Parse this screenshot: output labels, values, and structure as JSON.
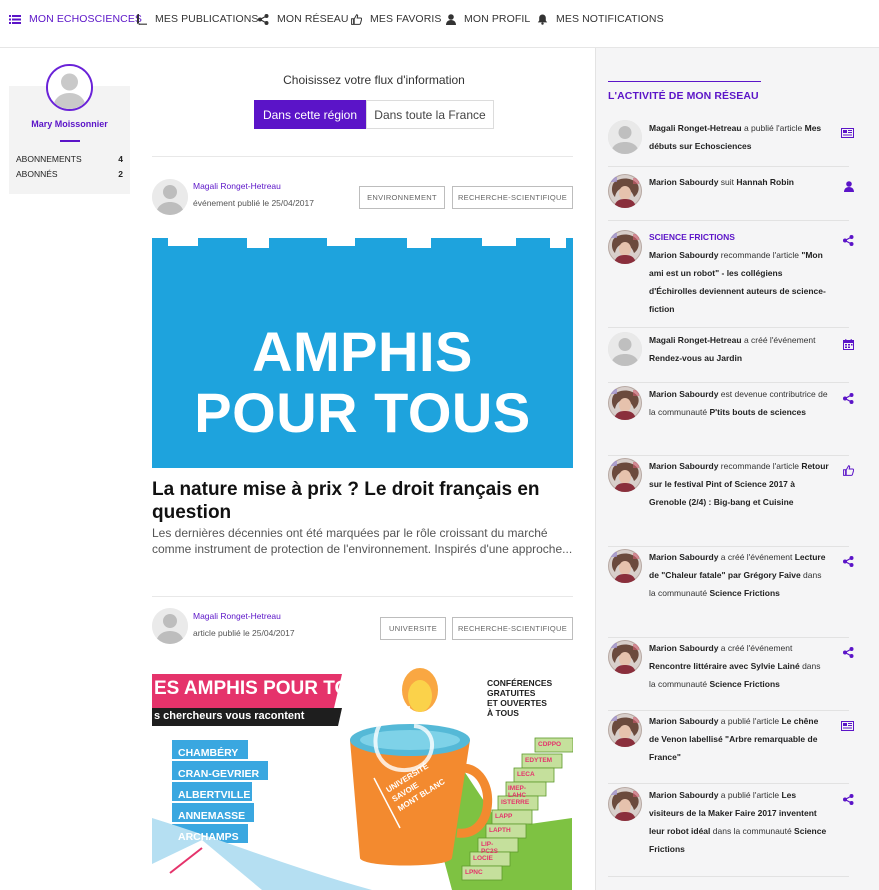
{
  "nav": {
    "items": [
      {
        "label": "MON ECHOSCIENCES",
        "icon": "list-icon",
        "active": true
      },
      {
        "label": "MES PUBLICATIONS",
        "icon": "book-icon",
        "active": false
      },
      {
        "label": "MON RÉSEAU",
        "icon": "share-icon",
        "active": false
      },
      {
        "label": "MES FAVORIS",
        "icon": "thumbs-up-icon",
        "active": false
      },
      {
        "label": "MON PROFIL",
        "icon": "user-icon",
        "active": false
      },
      {
        "label": "MES NOTIFICATIONS",
        "icon": "bell-icon",
        "active": false
      }
    ]
  },
  "profile": {
    "name": "Mary Moissonnier",
    "stats": [
      {
        "label": "ABONNEMENTS",
        "value": "4"
      },
      {
        "label": "ABONNÉS",
        "value": "2"
      }
    ]
  },
  "feed": {
    "title": "Choisissez votre flux d'information",
    "options": [
      "Dans cette région",
      "Dans toute la France"
    ],
    "selected": "Dans cette région",
    "posts": [
      {
        "author": "Magali Ronget-Hetreau",
        "meta": "événement publié le 25/04/2017",
        "tags": [
          "ENVIRONNEMENT",
          "RECHERCHE-SCIENTIFIQUE"
        ],
        "image_text": [
          "AMPHIS",
          "POUR TOUS"
        ],
        "title": "La nature mise à prix ? Le droit français en question",
        "excerpt": "Les dernières décennies ont été marquées par le rôle croissant du marché comme instrument de protection de l'environnement. Inspirés d'une approche..."
      },
      {
        "author": "Magali Ronget-Hetreau",
        "meta": "article publié le 25/04/2017",
        "tags": [
          "UNIVERSITE",
          "RECHERCHE-SCIENTIFIQUE"
        ],
        "image_text": {
          "banner": "ES AMPHIS POUR TOUS",
          "subtitle": "s chercheurs vous racontent",
          "cities": [
            "CHAMBÉRY",
            "CRAN-GEVRIER",
            "ALBERTVILLE",
            "ANNEMASSE",
            "ARCHAMPS"
          ],
          "tagline": [
            "CONFÉRENCES",
            "GRATUITES",
            "ET OUVERTES",
            "À TOUS"
          ],
          "mug": [
            "UNIVERSITÉ",
            "SAVOIE",
            "MONT BLANC"
          ],
          "files": [
            "CDPPO",
            "EDYTEM",
            "LECA",
            "IMEP-LAHC",
            "ISTERRE",
            "LAPP",
            "LAPTH",
            "LIP-PC2S",
            "LOCIE",
            "LPNC"
          ]
        }
      }
    ]
  },
  "activity": {
    "title": "L'ACTIVITÉ DE MON RÉSEAU",
    "items": [
      {
        "icon": "newspaper-icon",
        "avatar": "default",
        "group": "",
        "parts": [
          [
            "b",
            "Magali Ronget-Hetreau"
          ],
          [
            "t",
            " a publié l'article "
          ],
          [
            "b",
            "Mes débuts sur Echosciences"
          ]
        ]
      },
      {
        "icon": "user-icon",
        "avatar": "photo",
        "group": "",
        "parts": [
          [
            "b",
            "Marion Sabourdy"
          ],
          [
            "t",
            " suit "
          ],
          [
            "b",
            "Hannah Robin"
          ]
        ]
      },
      {
        "icon": "share-icon",
        "avatar": "photo",
        "group": "SCIENCE FRICTIONS",
        "parts": [
          [
            "b",
            "Marion Sabourdy"
          ],
          [
            "t",
            " recommande l'article "
          ],
          [
            "b",
            "\"Mon ami est un robot\" - les collégiens d'Échirolles deviennent auteurs de science-fiction"
          ]
        ]
      },
      {
        "icon": "calendar-icon",
        "avatar": "default",
        "group": "",
        "parts": [
          [
            "b",
            "Magali Ronget-Hetreau"
          ],
          [
            "t",
            " a créé l'événement "
          ],
          [
            "b",
            "Rendez-vous au Jardin"
          ]
        ]
      },
      {
        "icon": "share-icon",
        "avatar": "photo",
        "group": "",
        "parts": [
          [
            "b",
            "Marion Sabourdy"
          ],
          [
            "t",
            " est devenue contributrice de la communauté "
          ],
          [
            "b",
            "P'tits bouts de sciences"
          ]
        ]
      },
      {
        "icon": "thumbs-up-icon",
        "avatar": "photo",
        "group": "",
        "parts": [
          [
            "b",
            "Marion Sabourdy"
          ],
          [
            "t",
            " recommande l'article "
          ],
          [
            "b",
            "Retour sur le festival Pint of Science 2017 à Grenoble (2/4) : Big-bang et Cuisine"
          ]
        ]
      },
      {
        "icon": "share-icon",
        "avatar": "photo",
        "group": "",
        "parts": [
          [
            "b",
            "Marion Sabourdy"
          ],
          [
            "t",
            " a créé l'événement "
          ],
          [
            "b",
            "Lecture de \"Chaleur fatale\" par Grégory Faive"
          ],
          [
            "t",
            " dans la communauté "
          ],
          [
            "b",
            "Science Frictions"
          ]
        ]
      },
      {
        "icon": "share-icon",
        "avatar": "photo",
        "group": "",
        "parts": [
          [
            "b",
            "Marion Sabourdy"
          ],
          [
            "t",
            " a créé l'événement "
          ],
          [
            "b",
            "Rencontre littéraire avec Sylvie Lainé"
          ],
          [
            "t",
            " dans la communauté "
          ],
          [
            "b",
            "Science Frictions"
          ]
        ]
      },
      {
        "icon": "newspaper-icon",
        "avatar": "photo",
        "group": "",
        "parts": [
          [
            "b",
            "Marion Sabourdy"
          ],
          [
            "t",
            " a publié l'article "
          ],
          [
            "b",
            "Le chêne de Venon labellisé \"Arbre remarquable de France\""
          ]
        ]
      },
      {
        "icon": "share-icon",
        "avatar": "photo",
        "group": "",
        "parts": [
          [
            "b",
            "Marion Sabourdy"
          ],
          [
            "t",
            " a publié l'article "
          ],
          [
            "b",
            "Les visiteurs de la Maker Faire 2017 inventent leur robot idéal"
          ],
          [
            "t",
            " dans la communauté "
          ],
          [
            "b",
            "Science Frictions"
          ]
        ]
      }
    ]
  },
  "colors": {
    "accent": "#5b14c8",
    "banner_blue": "#1ea3dd",
    "pink": "#e5336b"
  }
}
